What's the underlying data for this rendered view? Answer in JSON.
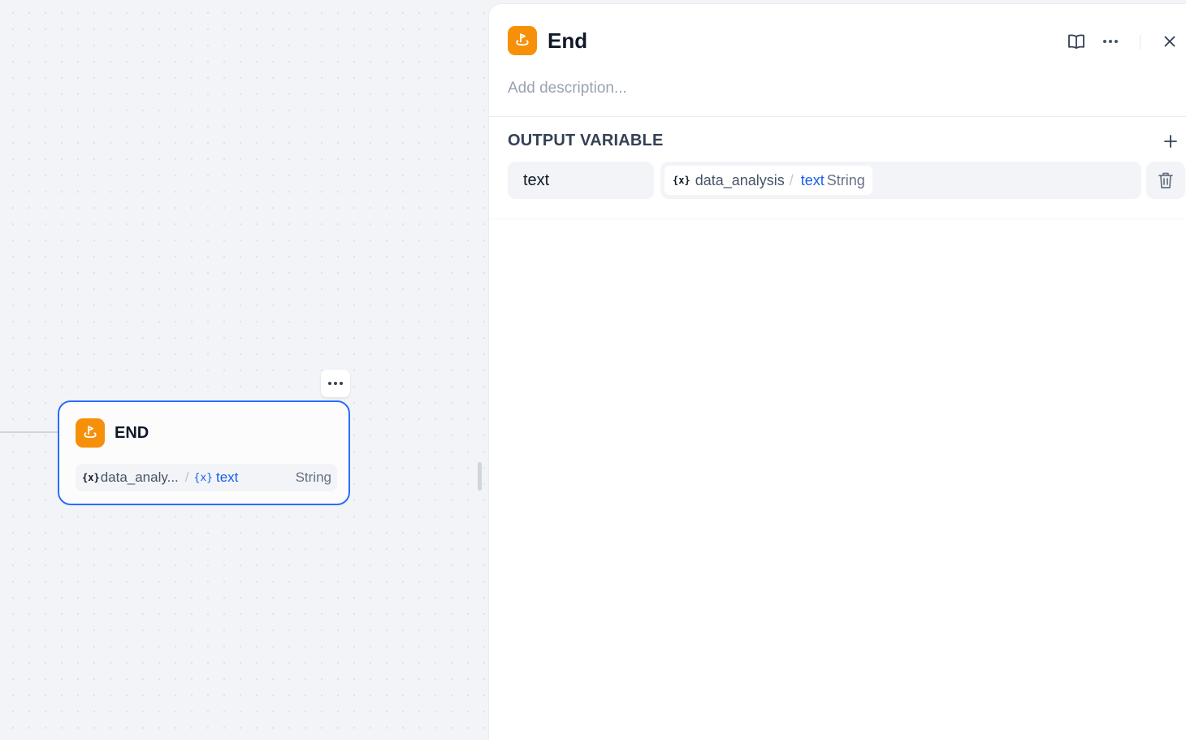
{
  "canvas": {
    "node": {
      "title": "END",
      "icon": "end-flag-icon",
      "variable": {
        "source": "data_analy...",
        "separator": "/",
        "field": "text",
        "type": "String"
      },
      "more_icon": "more-horizontal-icon"
    }
  },
  "panel": {
    "title": "End",
    "icon": "end-flag-icon",
    "description_placeholder": "Add description...",
    "header_actions": [
      "book-open-icon",
      "more-horizontal-icon",
      "close-icon"
    ],
    "output_section": {
      "title": "OUTPUT VARIABLE",
      "add_icon": "plus-icon",
      "variables": [
        {
          "name": "text",
          "source": "data_analysis",
          "separator": "/",
          "field": "text",
          "type": "String",
          "delete_icon": "trash-icon"
        }
      ]
    }
  },
  "colors": {
    "accent": "#296dff",
    "node_icon_bg": "#f79009",
    "variable_blue": "#155eef"
  }
}
